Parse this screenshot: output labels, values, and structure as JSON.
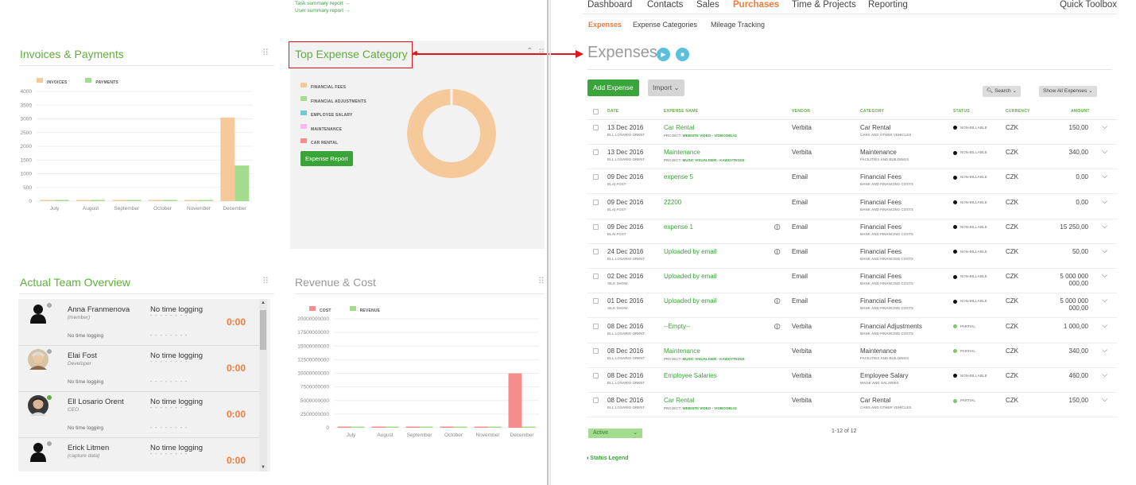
{
  "links": {
    "task_summary": "Task summary report →",
    "user_summary": "User summary report →"
  },
  "invoices": {
    "title": "Invoices & Payments",
    "legend": [
      {
        "name": "INVOICES",
        "color": "#f5c99a"
      },
      {
        "name": "PAYMENTS",
        "color": "#a3dc8c"
      }
    ],
    "chart_data": {
      "type": "bar",
      "categories": [
        "July",
        "August",
        "September",
        "October",
        "November",
        "December"
      ],
      "series": [
        {
          "name": "INVOICES",
          "values": [
            20,
            20,
            20,
            20,
            20,
            3050
          ]
        },
        {
          "name": "PAYMENTS",
          "values": [
            20,
            20,
            20,
            20,
            20,
            1300
          ]
        }
      ],
      "yticks": [
        "4000",
        "3500",
        "3000",
        "2500",
        "2000",
        "1500",
        "1000",
        "500",
        "0"
      ],
      "ylim": [
        0,
        4000
      ]
    }
  },
  "top_expense": {
    "title": "Top Expense Category",
    "legend": [
      {
        "name": "FINANCIAL FEES",
        "color": "#f5c99a"
      },
      {
        "name": "FINANCIAL ADJUSTMENTS",
        "color": "#a3dc8c"
      },
      {
        "name": "EMPLOYEE SALARY",
        "color": "#72c7d8"
      },
      {
        "name": "MAINTENANCE",
        "color": "#f6b8ef"
      },
      {
        "name": "CAR RENTAL",
        "color": "#f58d8d"
      }
    ],
    "button": "Expense Report",
    "chart_data": {
      "type": "pie",
      "labels": [
        "FINANCIAL FEES",
        "FINANCIAL ADJUSTMENTS",
        "EMPLOYEE SALARY",
        "MAINTENANCE",
        "CAR RENTAL"
      ],
      "values": [
        99.6,
        0.1,
        0.1,
        0.1,
        0.1
      ]
    }
  },
  "team": {
    "title": "Actual Team Overview",
    "members": [
      {
        "name": "Anna Franmenova",
        "role": "(member)",
        "status": "No time logging",
        "dash": "- - - - - - - -",
        "time": "0:00",
        "sub": "No time logging",
        "dash2": "- - - - - - - -",
        "avatar": "silhouette",
        "online": "#aaa"
      },
      {
        "name": "Elai Fost",
        "role": "Developer",
        "status": "No time logging",
        "dash": "- - - - - - - -",
        "time": "0:00",
        "sub": "No time logging",
        "dash2": "- - - - - - - -",
        "avatar": "photo-old",
        "online": "#aaa"
      },
      {
        "name": "Ell Losario Orent",
        "role": "CEO",
        "status": "No time logging",
        "dash": "- - - - - - - -",
        "time": "0:00",
        "sub": "No time logging",
        "dash2": "- - - - - - - -",
        "avatar": "photo-young",
        "online": "#5fae3c"
      },
      {
        "name": "Erick Litmen",
        "role": "(capture data)",
        "status": "No time logging",
        "dash": "- - - - - - - -",
        "time": "0:00",
        "avatar": "silhouette",
        "online": "#aaa"
      }
    ]
  },
  "revenue": {
    "title": "Revenue & Cost",
    "legend": [
      {
        "name": "COST",
        "color": "#f58d8d"
      },
      {
        "name": "REVENUE",
        "color": "#a3dc8c"
      }
    ],
    "chart_data": {
      "type": "bar",
      "categories": [
        "July",
        "August",
        "September",
        "October",
        "November",
        "December"
      ],
      "series": [
        {
          "name": "COST",
          "values": [
            0,
            0,
            0,
            0,
            0,
            10000000000
          ]
        },
        {
          "name": "REVENUE",
          "values": [
            0,
            0,
            0,
            0,
            0,
            0
          ]
        }
      ],
      "yticks": [
        "20000000000",
        "17500000000",
        "15000000000",
        "12500000000",
        "10000000000",
        "7500000000",
        "5000000000",
        "2500000000",
        "0"
      ],
      "ylim": [
        0,
        20000000000
      ]
    }
  },
  "nav": {
    "items": [
      "Dashboard",
      "Contacts",
      "Sales",
      "Purchases",
      "Time & Projects",
      "Reporting"
    ],
    "active": "Purchases",
    "toolbox": "Quick Toolbox",
    "sub": [
      "Expenses",
      "Expense Categories",
      "Mileage Tracking"
    ]
  },
  "page": {
    "title": "Expenses",
    "add_button": "Add Expense",
    "import_button": "Import",
    "search_button": "Search",
    "filter_button": "Show All Expenses",
    "columns": [
      "DATE",
      "EXPENSE NAME",
      "VENDOR",
      "CATEGORY",
      "STATUS",
      "CURRENCY",
      "AMOUNT"
    ],
    "rows": [
      {
        "date": "13 Dec 2016",
        "person": "ELL LOSARIO ORENT",
        "name": "Car Rental",
        "project": "PROJECT:",
        "project_name": "WEBSITE VIDEO - VIOBOOBLIG",
        "clip": false,
        "vendor": "Verbita",
        "category": "Car Rental",
        "cat_sub": "CARS AND OTHER VEHICLES",
        "status": "NON-BILLABLE",
        "status_color": "#111",
        "currency": "CZK",
        "amount": "150,00",
        "amount2": ""
      },
      {
        "date": "13 Dec 2016",
        "person": "ELL LOSARIO ORENT",
        "name": "Maintenance",
        "project": "PROJECT:",
        "project_name": "MUSIC VISUALISER - KAWGYTE3G5",
        "clip": false,
        "vendor": "Verbita",
        "category": "Maintenance",
        "cat_sub": "FACILITIES AND BUILDINGS",
        "status": "NON-BILLABLE",
        "status_color": "#111",
        "currency": "CZK",
        "amount": "340,00",
        "amount2": ""
      },
      {
        "date": "09 Dec 2016",
        "person": "ELAI FOST",
        "name": "expense 5",
        "project": "",
        "project_name": "",
        "clip": false,
        "vendor": "Email",
        "category": "Financial Fees",
        "cat_sub": "BANK AND FINANCING COSTS",
        "status": "NON-BILLABLE",
        "status_color": "#111",
        "currency": "CZK",
        "amount": "0,00",
        "amount2": ""
      },
      {
        "date": "09 Dec 2016",
        "person": "ELAI FOST",
        "name": "22200",
        "project": "",
        "project_name": "",
        "clip": false,
        "vendor": "Email",
        "category": "Financial Fees",
        "cat_sub": "BANK AND FINANCING COSTS",
        "status": "NON-BILLABLE",
        "status_color": "#111",
        "currency": "CZK",
        "amount": "0,00",
        "amount2": ""
      },
      {
        "date": "09 Dec 2016",
        "person": "ELAI FOST",
        "name": "expense 1",
        "project": "",
        "project_name": "",
        "clip": true,
        "vendor": "Email",
        "category": "Financial Fees",
        "cat_sub": "BANK AND FINANCING COSTS",
        "status": "NON-BILLABLE",
        "status_color": "#111",
        "currency": "CZK",
        "amount": "15 250,00",
        "amount2": ""
      },
      {
        "date": "24 Dec 2016",
        "person": "ELL LOSARIO ORENT",
        "name": "Uploaded by email",
        "project": "",
        "project_name": "",
        "clip": true,
        "vendor": "Email",
        "category": "Financial Fees",
        "cat_sub": "BANK AND FINANCING COSTS",
        "status": "NON-BILLABLE",
        "status_color": "#111",
        "currency": "CZK",
        "amount": "50,00",
        "amount2": ""
      },
      {
        "date": "02 Dec 2016",
        "person": "SILK SHOW",
        "name": "Uploaded by email",
        "project": "",
        "project_name": "",
        "clip": false,
        "vendor": "Email",
        "category": "Financial Fees",
        "cat_sub": "BANK AND FINANCING COSTS",
        "status": "NON-BILLABLE",
        "status_color": "#111",
        "currency": "CZK",
        "amount": "5 000 000",
        "amount2": "000,00"
      },
      {
        "date": "01 Dec 2016",
        "person": "SILK SHOW",
        "name": "Uploaded by email",
        "project": "",
        "project_name": "",
        "clip": true,
        "vendor": "Email",
        "category": "Financial Fees",
        "cat_sub": "BANK AND FINANCING COSTS",
        "status": "NON-BILLABLE",
        "status_color": "#111",
        "currency": "CZK",
        "amount": "5 000 000",
        "amount2": "000,00"
      },
      {
        "date": "08 Dec 2016",
        "person": "ELL LOSARIO ORENT",
        "name": "--Empty--",
        "project": "",
        "project_name": "",
        "clip": true,
        "vendor": "Verbita",
        "category": "Financial Adjustments",
        "cat_sub": "BANK AND FINANCING COSTS",
        "status": "PARTIAL",
        "status_color": "#7cc86a",
        "currency": "CZK",
        "amount": "1 000,00",
        "amount2": ""
      },
      {
        "date": "08 Dec 2016",
        "person": "ELL LOSARIO ORENT",
        "name": "Maintenance",
        "project": "PROJECT:",
        "project_name": "MUSIC VISUALISER - KAWGYTE3G5",
        "clip": false,
        "vendor": "Verbita",
        "category": "Maintenance",
        "cat_sub": "FACILITIES AND BUILDINGS",
        "status": "PARTIAL",
        "status_color": "#7cc86a",
        "currency": "CZK",
        "amount": "340,00",
        "amount2": ""
      },
      {
        "date": "08 Dec 2016",
        "person": "ELL LOSARIO ORENT",
        "name": "Employee Salaries",
        "project": "",
        "project_name": "",
        "clip": false,
        "vendor": "Verbita",
        "category": "Employee Salary",
        "cat_sub": "WAGE AND SALARIES",
        "status": "NON-BILLABLE",
        "status_color": "#111",
        "currency": "CZK",
        "amount": "460,00",
        "amount2": ""
      },
      {
        "date": "08 Dec 2016",
        "person": "ELL LOSARIO ORENT",
        "name": "Car Rental",
        "project": "PROJECT:",
        "project_name": "WEBSITE VIDEO - VIOBOOBLIG",
        "clip": false,
        "vendor": "Verbita",
        "category": "Car Rental",
        "cat_sub": "CARS AND OTHER VEHICLES",
        "status": "PARTIAL",
        "status_color": "#7cc86a",
        "currency": "CZK",
        "amount": "150,00",
        "amount2": ""
      }
    ],
    "active_filter": "Active",
    "pager": "1-12 of 12",
    "status_legend": "Status Legend"
  }
}
